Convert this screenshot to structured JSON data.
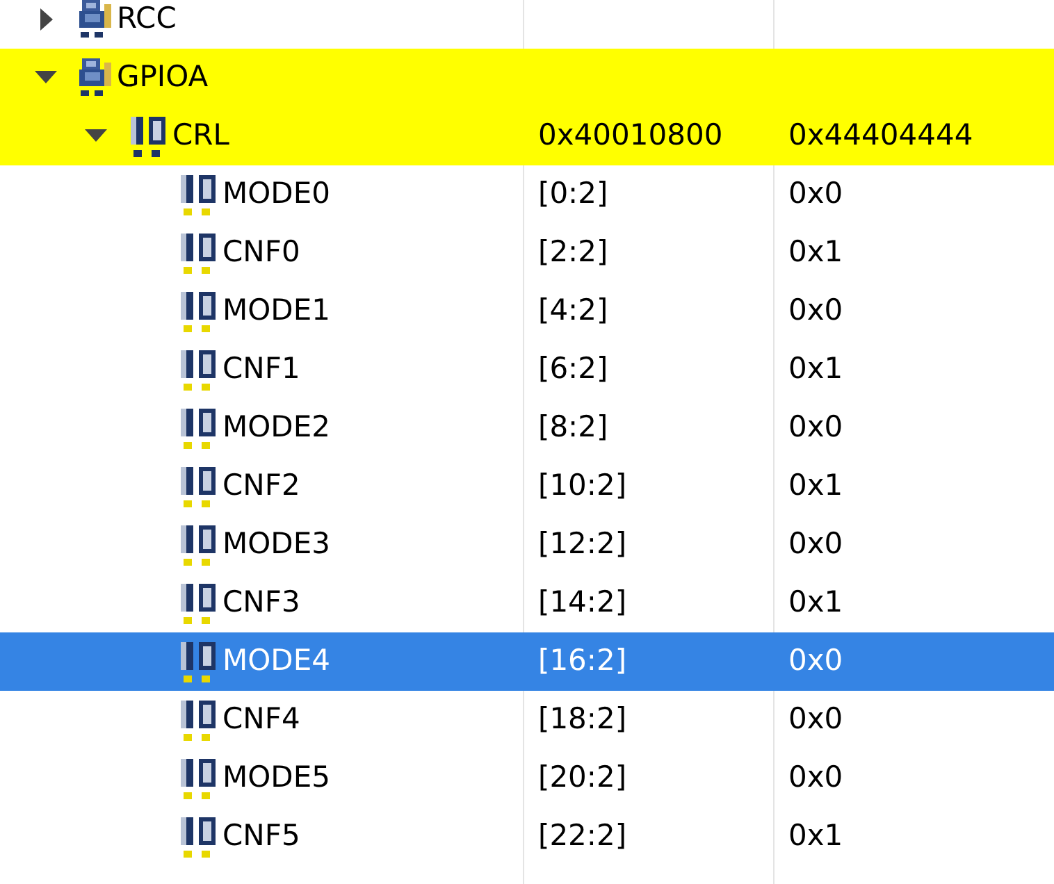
{
  "tree": [
    {
      "kind": "peripheral",
      "name": "RCC",
      "expanded": false,
      "highlighted": false,
      "selected": false
    },
    {
      "kind": "peripheral",
      "name": "GPIOA",
      "expanded": true,
      "highlighted": true,
      "selected": false,
      "children": [
        {
          "kind": "register",
          "name": "CRL",
          "address": "0x40010800",
          "value": "0x44404444",
          "expanded": true,
          "highlighted": true,
          "selected": false,
          "children": [
            {
              "kind": "field",
              "name": "MODE0",
              "bits": "[0:2]",
              "value": "0x0",
              "highlighted": false,
              "selected": false
            },
            {
              "kind": "field",
              "name": "CNF0",
              "bits": "[2:2]",
              "value": "0x1",
              "highlighted": false,
              "selected": false
            },
            {
              "kind": "field",
              "name": "MODE1",
              "bits": "[4:2]",
              "value": "0x0",
              "highlighted": false,
              "selected": false
            },
            {
              "kind": "field",
              "name": "CNF1",
              "bits": "[6:2]",
              "value": "0x1",
              "highlighted": false,
              "selected": false
            },
            {
              "kind": "field",
              "name": "MODE2",
              "bits": "[8:2]",
              "value": "0x0",
              "highlighted": false,
              "selected": false
            },
            {
              "kind": "field",
              "name": "CNF2",
              "bits": "[10:2]",
              "value": "0x1",
              "highlighted": false,
              "selected": false
            },
            {
              "kind": "field",
              "name": "MODE3",
              "bits": "[12:2]",
              "value": "0x0",
              "highlighted": false,
              "selected": false
            },
            {
              "kind": "field",
              "name": "CNF3",
              "bits": "[14:2]",
              "value": "0x1",
              "highlighted": false,
              "selected": false
            },
            {
              "kind": "field",
              "name": "MODE4",
              "bits": "[16:2]",
              "value": "0x0",
              "highlighted": false,
              "selected": true
            },
            {
              "kind": "field",
              "name": "CNF4",
              "bits": "[18:2]",
              "value": "0x0",
              "highlighted": false,
              "selected": false
            },
            {
              "kind": "field",
              "name": "MODE5",
              "bits": "[20:2]",
              "value": "0x0",
              "highlighted": false,
              "selected": false
            },
            {
              "kind": "field",
              "name": "CNF5",
              "bits": "[22:2]",
              "value": "0x1",
              "highlighted": false,
              "selected": false
            }
          ]
        }
      ]
    }
  ]
}
